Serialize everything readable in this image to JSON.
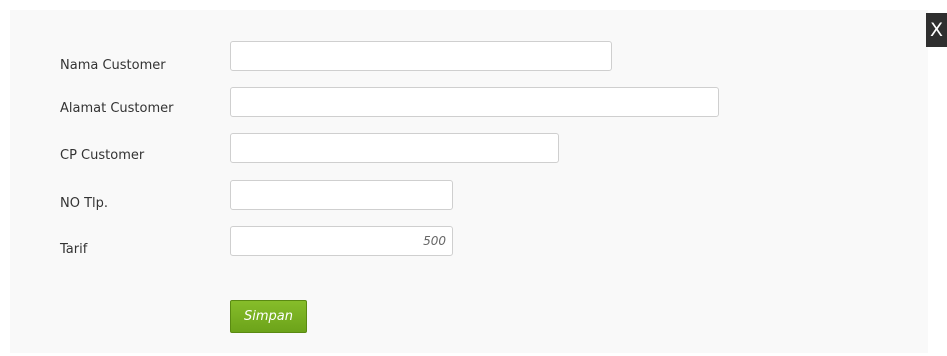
{
  "modal": {
    "close_label": "X"
  },
  "form": {
    "fields": [
      {
        "label": "Nama Customer",
        "value": ""
      },
      {
        "label": "Alamat Customer",
        "value": ""
      },
      {
        "label": "CP Customer",
        "value": ""
      },
      {
        "label": "NO Tlp.",
        "value": ""
      },
      {
        "label": "Tarif",
        "value": "500"
      }
    ],
    "submit_label": "Simpan"
  },
  "colors": {
    "button_green": "#78b222",
    "close_bg": "#2f2f2f",
    "panel_bg": "#f9f9f9"
  }
}
